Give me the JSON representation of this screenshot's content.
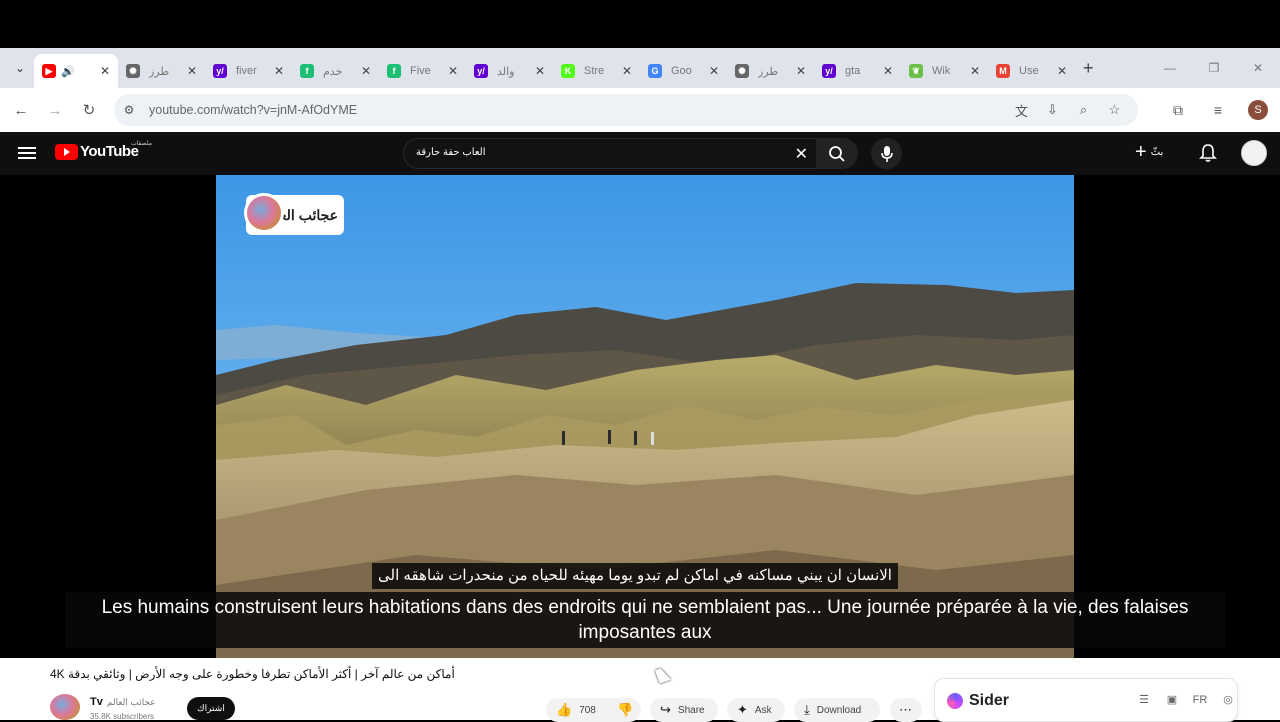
{
  "browser": {
    "tabs": [
      {
        "title": "",
        "favicon": "youtube-icon",
        "color": "#ff0000",
        "active": true
      },
      {
        "title": "طرز",
        "favicon": "openai-icon",
        "color": "#666666"
      },
      {
        "title": "fiver",
        "favicon": "yahoo-icon",
        "color": "#6001d2"
      },
      {
        "title": "خدم",
        "favicon": "fiverr-icon",
        "color": "#1dbf73"
      },
      {
        "title": "Five",
        "favicon": "fiverr-icon",
        "color": "#1dbf73"
      },
      {
        "title": "والد",
        "favicon": "yahoo-icon",
        "color": "#6001d2"
      },
      {
        "title": "Stre",
        "favicon": "kick-icon",
        "color": "#53fc18"
      },
      {
        "title": "Goo",
        "favicon": "google-icon",
        "color": "#4285f4"
      },
      {
        "title": "طرز",
        "favicon": "openai-icon",
        "color": "#666666"
      },
      {
        "title": "gta",
        "favicon": "yahoo-icon",
        "color": "#6001d2"
      },
      {
        "title": "Wik",
        "favicon": "leaf-icon",
        "color": "#6cc04a"
      },
      {
        "title": "Use",
        "favicon": "gmail-icon",
        "color": "#ea4335"
      }
    ],
    "url": "youtube.com/watch?v=jnM-AfOdYME",
    "profile_initial": "S"
  },
  "youtube": {
    "logo_text": "YouTube",
    "logo_sub": "ملصقات",
    "search_query": "العاب حفة حارقة",
    "create_label": "بثّ",
    "channel_logo_text": "عجائب العالم",
    "caption_ar": "الانسان ان يبني مساكنه في اماكن لم تبدو يوما مهيئه للحياه من منحدرات شاهقه الى",
    "caption_fr": "Les humains construisent leurs habitations dans des endroits qui ne semblaient pas... Une journée préparée à la vie, des falaises imposantes aux",
    "video_title": "أماكن من عالم آخر | أكثر الأماكن تطرفا وخطورة على وجه الأرض | وثائقي بدقة 4K",
    "channel_name": "Tv",
    "channel_name_ar": "عجائب العالم",
    "subscribers": "35.8K subscribers",
    "subscribe_label": "اشتراك",
    "likes": "708",
    "share_label": "Share",
    "ask_label": "Ask",
    "download_label": "Download"
  },
  "sider": {
    "name": "Sider",
    "lang": "FR"
  }
}
